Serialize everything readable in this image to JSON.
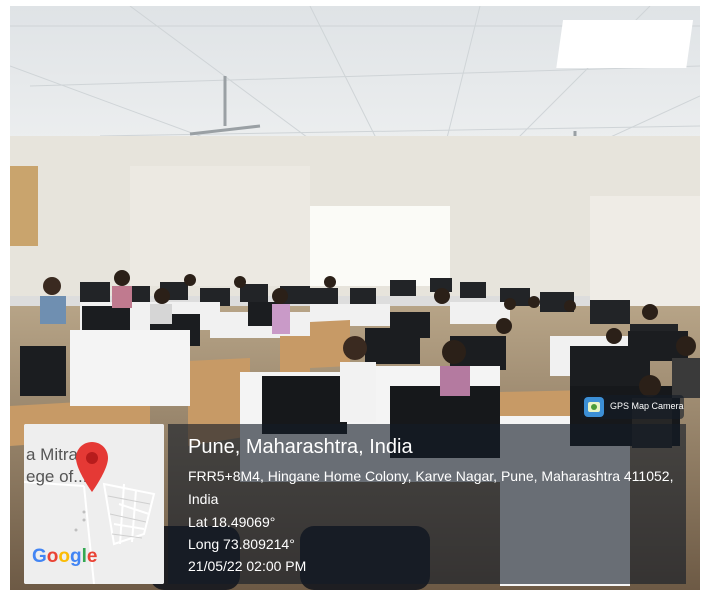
{
  "photo": {
    "subject": "computer-lab-with-students",
    "colors": {
      "ceiling": "#e9ecee",
      "wall": "#e7e4dc",
      "floor": "#9a8468",
      "desk": "#c79a66",
      "monitor": "#1b1d20",
      "divider": "#f1f1f1"
    }
  },
  "gps_badge": {
    "label": "GPS Map Camera",
    "icon": "gps-map-camera-icon"
  },
  "map": {
    "place_text": "a Mitra\nege of...",
    "logo": "Google",
    "pin_icon": "location-pin-icon"
  },
  "location": {
    "title": "Pune, Maharashtra, India",
    "address_line1": "FRR5+8M4, Hingane Home Colony, Karve Nagar, Pune, Maharashtra 411052,",
    "address_line2": "India",
    "lat": "Lat 18.49069°",
    "long": "Long 73.809214°",
    "datetime": "21/05/22 02:00 PM"
  }
}
